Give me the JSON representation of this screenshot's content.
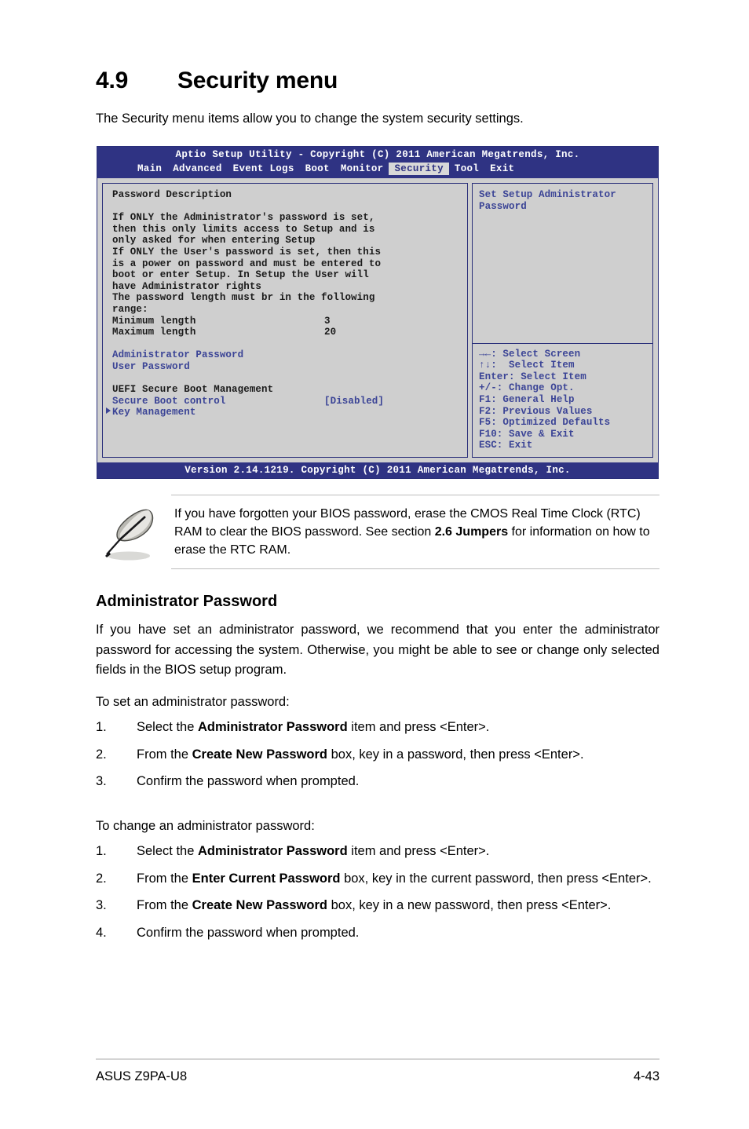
{
  "heading": {
    "number": "4.9",
    "title": "Security menu"
  },
  "intro": "The Security menu items allow you to change the system security settings.",
  "bios": {
    "titlebar": "Aptio Setup Utility - Copyright (C) 2011 American Megatrends, Inc.",
    "menu": [
      {
        "label": "Main",
        "active": false
      },
      {
        "label": "Advanced",
        "active": false
      },
      {
        "label": "Event Logs",
        "active": false
      },
      {
        "label": "Boot",
        "active": false
      },
      {
        "label": "Monitor",
        "active": false
      },
      {
        "label": "Security",
        "active": true
      },
      {
        "label": "Tool",
        "active": false
      },
      {
        "label": "Exit",
        "active": false
      }
    ],
    "left_lines": [
      {
        "text": "Password Description",
        "style": "dark"
      },
      {
        "text": "",
        "style": "spacer"
      },
      {
        "text": "If ONLY the Administrator's password is set,",
        "style": "dark"
      },
      {
        "text": "then this only limits access to Setup and is",
        "style": "dark"
      },
      {
        "text": "only asked for when entering Setup",
        "style": "dark"
      },
      {
        "text": "If ONLY the User's password is set, then this",
        "style": "dark"
      },
      {
        "text": "is a power on password and must be entered to",
        "style": "dark"
      },
      {
        "text": "boot or enter Setup. In Setup the User will",
        "style": "dark"
      },
      {
        "text": "have Administrator rights",
        "style": "dark"
      },
      {
        "text": "The password length must br in the following",
        "style": "dark"
      },
      {
        "text": "range:",
        "style": "dark"
      },
      {
        "label": "Minimum length",
        "value": "3",
        "style": "dark-row"
      },
      {
        "label": "Maximum length",
        "value": "20",
        "style": "dark-row"
      },
      {
        "text": "",
        "style": "spacer"
      },
      {
        "text": "Administrator Password",
        "style": "blue"
      },
      {
        "text": "User Password",
        "style": "blue"
      },
      {
        "text": "",
        "style": "spacer"
      },
      {
        "text": "UEFI Secure Boot Management",
        "style": "dark"
      },
      {
        "label": "Secure Boot control",
        "value": "[Disabled]",
        "style": "blue-row"
      },
      {
        "text": "Key Management",
        "style": "blue-arrow"
      }
    ],
    "help_title": [
      "Set Setup Administrator",
      "Password"
    ],
    "keys": [
      "→←: Select Screen",
      "↑↓:  Select Item",
      "Enter: Select Item",
      "+/-: Change Opt.",
      "F1: General Help",
      "F2: Previous Values",
      "F5: Optimized Defaults",
      "F10: Save & Exit",
      "ESC: Exit"
    ],
    "footer": "Version 2.14.1219. Copyright (C) 2011 American Megatrends, Inc.",
    "colors": {
      "bar_blue": "#2f3383",
      "panel_gray": "#cfcfcf",
      "item_blue": "#3b4496",
      "border_blue": "#2a2f7a"
    }
  },
  "note": {
    "icon": "quill-pen-icon",
    "part1": "If you have forgotten your BIOS password, erase the CMOS Real Time Clock (RTC) RAM to clear the BIOS password. See section ",
    "bold": "2.6 Jumpers",
    "part2": " for information on how to erase the RTC RAM."
  },
  "section": {
    "sub_heading": "Administrator Password",
    "para1": "If you have set an administrator password, we recommend that you enter the administrator password for accessing the system. Otherwise, you might be able to see or change only selected fields in the BIOS setup program.",
    "lead_set": "To set an administrator password:",
    "lead_change": "To change an administrator password:",
    "set_steps": [
      {
        "num": "1.",
        "pre": "Select the ",
        "bold": "Administrator Password",
        "post": " item and press <Enter>."
      },
      {
        "num": "2.",
        "pre": "From the ",
        "bold": "Create New Password",
        "post": " box, key in a password, then press <Enter>."
      },
      {
        "num": "3.",
        "pre": "Confirm the password when prompted.",
        "bold": "",
        "post": ""
      }
    ],
    "change_steps": [
      {
        "num": "1.",
        "pre": "Select the ",
        "bold": "Administrator Password",
        "post": " item and press <Enter>."
      },
      {
        "num": "2.",
        "pre": "From the ",
        "bold": "Enter Current Password",
        "post": " box, key in the current password, then press <Enter>."
      },
      {
        "num": "3.",
        "pre": "From the ",
        "bold": "Create New Password",
        "post": " box, key in a new password, then press <Enter>."
      },
      {
        "num": "4.",
        "pre": "Confirm the password when prompted.",
        "bold": "",
        "post": ""
      }
    ]
  },
  "page_footer": {
    "product": "ASUS Z9PA-U8",
    "page_number": "4-43"
  }
}
